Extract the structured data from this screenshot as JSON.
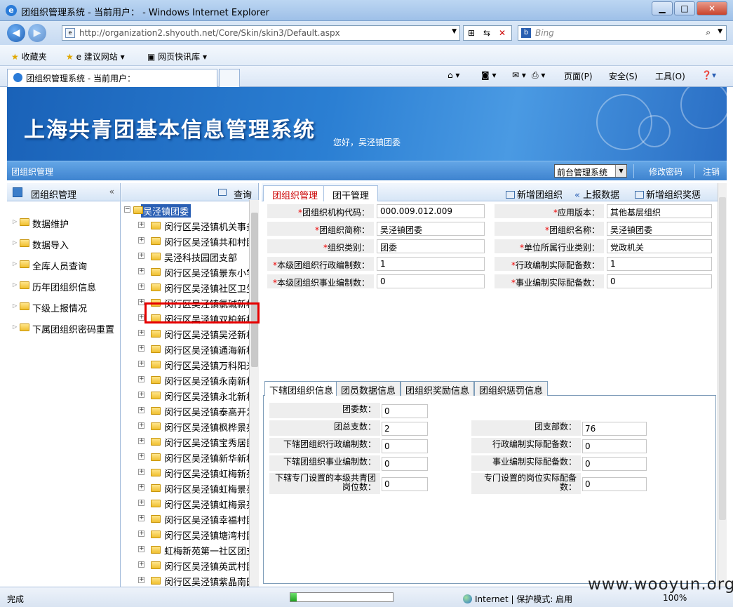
{
  "browser": {
    "title": "团组织管理系统 - 当前用户： - Windows Internet Explorer",
    "url": "http://organization2.shyouth.net/Core/Skin/skin3/Default.aspx",
    "search_placeholder": "Bing",
    "favorites_label": "收藏夹",
    "fav_links": [
      "建议网站",
      "网页快讯库"
    ],
    "tab_title": "团组织管理系统 - 当前用户：",
    "commands": [
      "页面(P)",
      "安全(S)",
      "工具(O)"
    ],
    "status_text": "完成",
    "progress": 0.06,
    "zone_text": "Internet | 保护模式: 启用",
    "zoom": "100%"
  },
  "banner": {
    "title": "上海共青团基本信息管理系统",
    "greeting": "您好，吴泾镇团委"
  },
  "subbar": {
    "section": "团组织管理",
    "system_select": "前台管理系统",
    "change_password": "修改密码",
    "logout": "注销"
  },
  "left_nav": {
    "title": "团组织管理",
    "collapse": "«",
    "items": [
      "数据维护",
      "数据导入",
      "全库人员查询",
      "历年团组织信息",
      "下级上报情况",
      "下属团组织密码重置"
    ]
  },
  "tree": {
    "query_label": "查询",
    "root": "吴泾镇团委",
    "nodes": [
      "闵行区吴泾镇机关事务",
      "闵行区吴泾镇共和村团",
      "吴泾科技园团支部",
      "闵行区吴泾镇景东小学",
      "闵行区吴泾镇社区卫生",
      "闵行区吴泾镇氯碱新村",
      "闵行区吴泾镇双柏新村",
      "闵行区吴泾镇吴泾新村",
      "闵行区吴泾镇通海新村",
      "闵行区吴泾镇万科阳光",
      "闵行区吴泾镇永南新村",
      "闵行区吴泾镇永北新村",
      "闵行区吴泾镇泰高开发",
      "闵行区吴泾镇枫桦景苑",
      "闵行区吴泾镇宝秀居民",
      "闵行区吴泾镇新华新村",
      "闵行区吴泾镇虹梅新苑",
      "闵行区吴泾镇虹梅景苑",
      "闵行区吴泾镇虹梅景苑",
      "闵行区吴泾镇幸福村团",
      "闵行区吴泾镇塘湾村团",
      "虹梅新苑第一社区团支",
      "闵行区吴泾镇英武村团",
      "闵行区吴泾镇紫晶南园"
    ]
  },
  "main": {
    "tabs": [
      "团组织管理",
      "团干管理"
    ],
    "tools": [
      "新增团组织",
      "上报数据",
      "新增组织奖惩"
    ],
    "fields": [
      {
        "label": "团组织机构代码：",
        "value": "000.009.012.009",
        "required": true
      },
      {
        "label": "应用版本：",
        "value": "其他基层组织",
        "required": true
      },
      {
        "label": "团组织简称：",
        "value": "吴泾镇团委",
        "required": true
      },
      {
        "label": "团组织名称：",
        "value": "吴泾镇团委",
        "required": true
      },
      {
        "label": "组织类别：",
        "value": "团委",
        "required": true
      },
      {
        "label": "单位所属行业类别：",
        "value": "党政机关",
        "required": true
      },
      {
        "label": "本级团组织行政编制数：",
        "value": "1",
        "required": true
      },
      {
        "label": "行政编制实际配备数：",
        "value": "1",
        "required": true
      },
      {
        "label": "本级团组织事业编制数：",
        "value": "0",
        "required": true
      },
      {
        "label": "事业编制实际配备数：",
        "value": "0",
        "required": true
      }
    ],
    "subtabs": [
      "下辖团组织信息",
      "团员数据信息",
      "团组织奖励信息",
      "团组织惩罚信息"
    ],
    "sub_fields": [
      {
        "label": "团委数：",
        "value": "0"
      },
      {
        "label": "团总支数：",
        "value": "2"
      },
      {
        "label": "团支部数：",
        "value": "76"
      },
      {
        "label": "下辖团组织行政编制数：",
        "value": "0"
      },
      {
        "label": "行政编制实际配备数：",
        "value": "0"
      },
      {
        "label": "下辖团组织事业编制数：",
        "value": "0"
      },
      {
        "label": "事业编制实际配备数：",
        "value": "0"
      },
      {
        "label": "下辖专门设置的本级共青团岗位数：",
        "value": "0"
      },
      {
        "label": "专门设置的岗位实际配备数：",
        "value": "0"
      }
    ]
  },
  "watermark": "www.wooyun.org",
  "colors": {
    "accent": "#2a5fb4",
    "banner": "#2b7fd3",
    "required": "#e00000",
    "highlight": "#e60000"
  }
}
